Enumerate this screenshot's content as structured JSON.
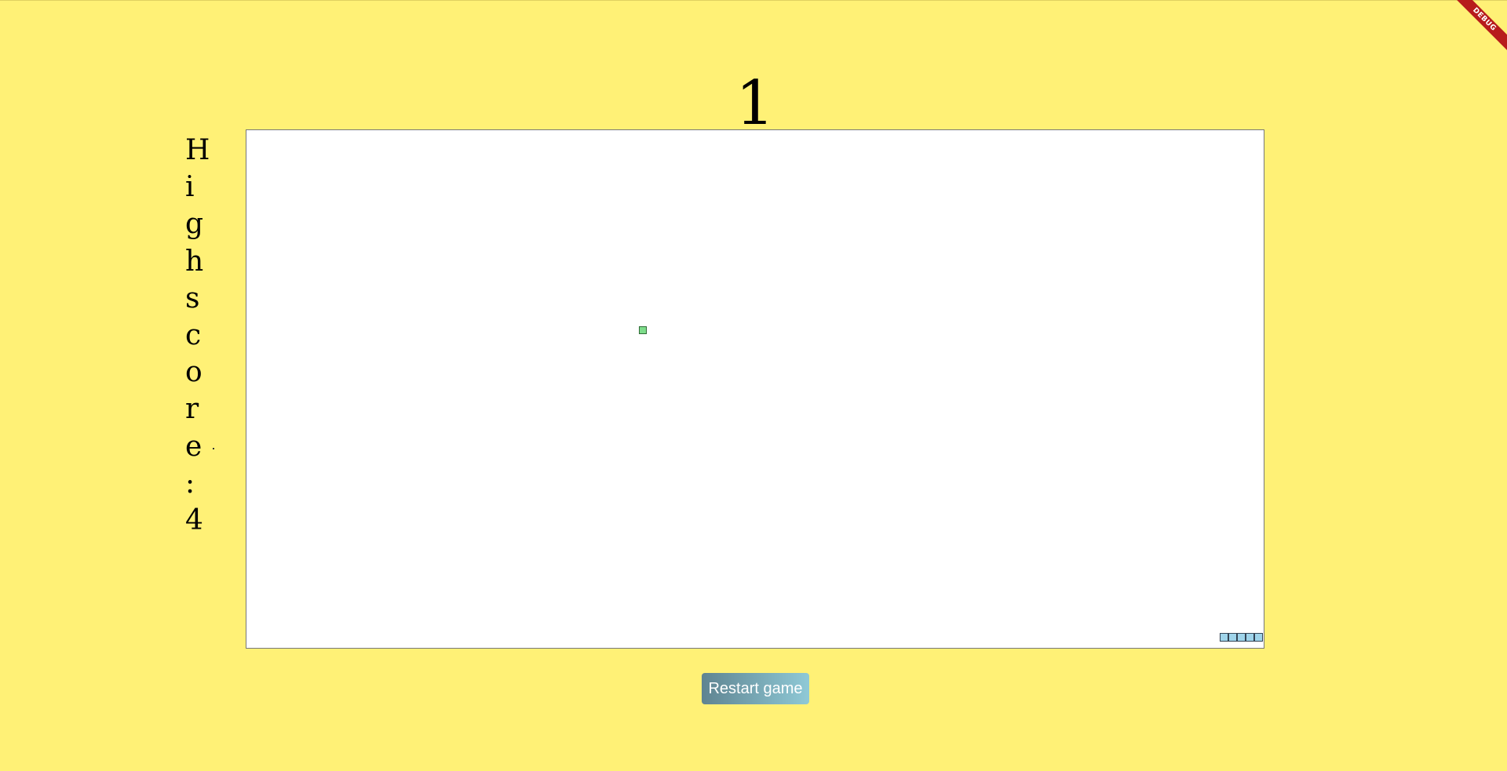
{
  "game": {
    "score": "1",
    "highscore_letters": [
      "H",
      "i",
      "g",
      "h",
      "s",
      "c",
      "o",
      "r",
      "e",
      ":",
      "4"
    ],
    "restart_label": "Restart game",
    "debug_banner": "DEBUG"
  },
  "board": {
    "food_color": "#7ddc8a",
    "snake_color": "#9fd4ea",
    "snake_length": 5
  },
  "colors": {
    "background": "#FFF176",
    "board": "#FFFFFF",
    "button_start": "#5f8491",
    "button_end": "#8fc9d6",
    "debug_ribbon": "#b71c1c"
  }
}
